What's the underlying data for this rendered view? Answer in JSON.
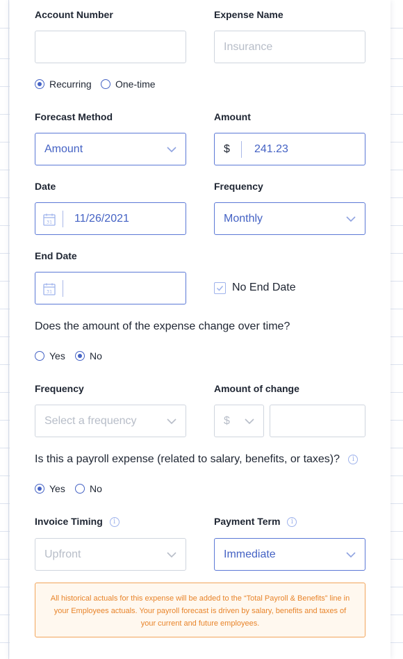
{
  "form": {
    "account_number_label": "Account Number",
    "account_number_value": "",
    "expense_name_label": "Expense Name",
    "expense_name_placeholder": "Insurance",
    "recurring_label": "Recurring",
    "onetime_label": "One-time",
    "forecast_method_label": "Forecast Method",
    "forecast_method_value": "Amount",
    "amount_label": "Amount",
    "currency_symbol": "$",
    "amount_value": "241.23",
    "date_label": "Date",
    "date_value": "11/26/2021",
    "frequency_label": "Frequency",
    "frequency_value": "Monthly",
    "end_date_label": "End Date",
    "end_date_value": "",
    "no_end_date_label": "No End Date",
    "change_question": "Does the amount of the expense change over time?",
    "yes_label": "Yes",
    "no_label": "No",
    "change_frequency_label": "Frequency",
    "change_frequency_placeholder": "Select a frequency",
    "amount_of_change_label": "Amount of change",
    "change_unit_value": "$",
    "amount_of_change_value": "",
    "payroll_question": "Is this a payroll expense (related to salary, benefits, or taxes)?",
    "invoice_timing_label": "Invoice Timing",
    "invoice_timing_value": "Upfront",
    "payment_term_label": "Payment Term",
    "payment_term_value": "Immediate",
    "notice_text": "All historical actuals for this expense will be added to the “Total Payroll & Benefits” line in your Employees actuals. Your payroll forecast is driven by salary, benefits and taxes of your current and future employees."
  },
  "state": {
    "recurring_selected": true,
    "change_over_time": "No",
    "payroll_expense": "Yes",
    "no_end_date_checked": true
  },
  "colors": {
    "accent": "#4462c4",
    "notice_border": "#f2a45a",
    "notice_text": "#e8842a"
  },
  "icons": {
    "calendar_day": "31",
    "info": "i"
  }
}
